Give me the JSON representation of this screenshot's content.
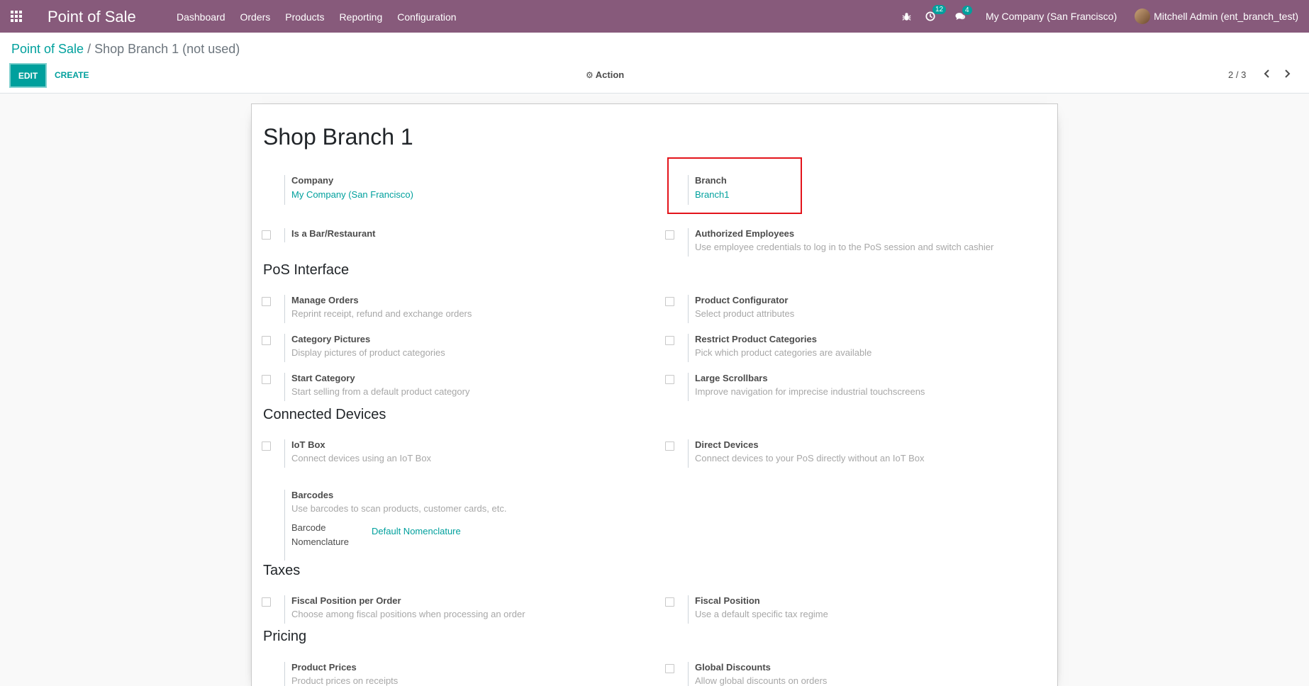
{
  "navbar": {
    "brand": "Point of Sale",
    "menu": [
      "Dashboard",
      "Orders",
      "Products",
      "Reporting",
      "Configuration"
    ],
    "activity_count": "12",
    "message_count": "4",
    "company": "My Company (San Francisco)",
    "user": "Mitchell Admin (ent_branch_test)"
  },
  "breadcrumb": {
    "parent": "Point of Sale",
    "separator": "/",
    "current": "Shop Branch 1 (not used)"
  },
  "buttons": {
    "edit": "EDIT",
    "create": "CREATE",
    "action": "Action"
  },
  "pager": {
    "value": "2 / 3"
  },
  "form": {
    "title": "Shop Branch 1",
    "company": {
      "label": "Company",
      "value": "My Company (San Francisco)"
    },
    "branch": {
      "label": "Branch",
      "value": "Branch1"
    },
    "is_bar": {
      "label": "Is a Bar/Restaurant"
    },
    "auth_employees": {
      "label": "Authorized Employees",
      "desc": "Use employee credentials to log in to the PoS session and switch cashier"
    },
    "sections": {
      "pos_interface": "PoS Interface",
      "connected_devices": "Connected Devices",
      "taxes": "Taxes",
      "pricing": "Pricing"
    },
    "manage_orders": {
      "label": "Manage Orders",
      "desc": "Reprint receipt, refund and exchange orders"
    },
    "product_configurator": {
      "label": "Product Configurator",
      "desc": "Select product attributes"
    },
    "category_pictures": {
      "label": "Category Pictures",
      "desc": "Display pictures of product categories"
    },
    "restrict_categories": {
      "label": "Restrict Product Categories",
      "desc": "Pick which product categories are available"
    },
    "start_category": {
      "label": "Start Category",
      "desc": "Start selling from a default product category"
    },
    "large_scrollbars": {
      "label": "Large Scrollbars",
      "desc": "Improve navigation for imprecise industrial touchscreens"
    },
    "iot_box": {
      "label": "IoT Box",
      "desc": "Connect devices using an IoT Box"
    },
    "direct_devices": {
      "label": "Direct Devices",
      "desc": "Connect devices to your PoS directly without an IoT Box"
    },
    "barcodes": {
      "label": "Barcodes",
      "desc": "Use barcodes to scan products, customer cards, etc.",
      "nomenclature_label_1": "Barcode",
      "nomenclature_label_2": "Nomenclature",
      "nomenclature_value": "Default Nomenclature"
    },
    "fiscal_position_per_order": {
      "label": "Fiscal Position per Order",
      "desc": "Choose among fiscal positions when processing an order"
    },
    "fiscal_position": {
      "label": "Fiscal Position",
      "desc": "Use a default specific tax regime"
    },
    "product_prices": {
      "label": "Product Prices",
      "desc": "Product prices on receipts"
    },
    "global_discounts": {
      "label": "Global Discounts",
      "desc": "Allow global discounts on orders"
    }
  },
  "colors": {
    "navbar": "#875a7b",
    "accent": "#00a09d",
    "highlight": "#e3141b"
  }
}
